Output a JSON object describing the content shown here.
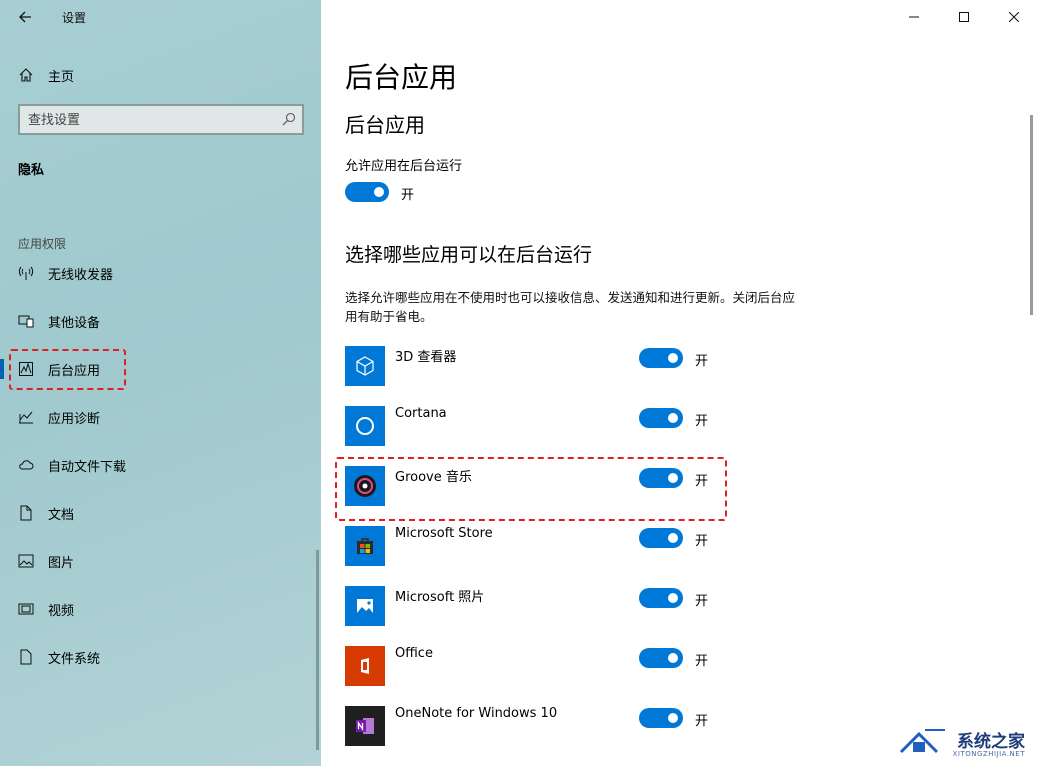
{
  "window": {
    "title": "设置"
  },
  "sidebar": {
    "home_label": "主页",
    "search_placeholder": "查找设置",
    "section": "隐私",
    "group": "应用权限",
    "items": [
      {
        "label": "无线收发器",
        "icon": "radio-tower-icon"
      },
      {
        "label": "其他设备",
        "icon": "devices-icon"
      },
      {
        "label": "后台应用",
        "icon": "background-apps-icon",
        "selected": true
      },
      {
        "label": "应用诊断",
        "icon": "diagnostics-icon"
      },
      {
        "label": "自动文件下载",
        "icon": "cloud-icon"
      },
      {
        "label": "文档",
        "icon": "document-icon"
      },
      {
        "label": "图片",
        "icon": "pictures-icon"
      },
      {
        "label": "视频",
        "icon": "video-icon"
      },
      {
        "label": "文件系统",
        "icon": "file-system-icon"
      }
    ]
  },
  "main": {
    "page_title": "后台应用",
    "sub_title": "后台应用",
    "allow_label": "允许应用在后台运行",
    "allow_state": "开",
    "choose_title": "选择哪些应用可以在后台运行",
    "description": "选择允许哪些应用在不使用时也可以接收信息、发送通知和进行更新。关闭后台应用有助于省电。",
    "apps": [
      {
        "name": "3D 查看器",
        "state": "开",
        "color": "#0078d7"
      },
      {
        "name": "Cortana",
        "state": "开",
        "color": "#0078d7"
      },
      {
        "name": "Groove 音乐",
        "state": "开",
        "color": "#0078d7"
      },
      {
        "name": "Microsoft Store",
        "state": "开",
        "color": "#0078d7"
      },
      {
        "name": "Microsoft 照片",
        "state": "开",
        "color": "#0078d7"
      },
      {
        "name": "Office",
        "state": "开",
        "color": "#d83b01"
      },
      {
        "name": "OneNote for Windows 10",
        "state": "开",
        "color": "#5c2d91"
      }
    ]
  },
  "watermark": {
    "text": "系统之家",
    "sub": "XITONGZHIJIA.NET"
  },
  "colors": {
    "accent": "#0078d7",
    "highlight": "#e02020"
  }
}
